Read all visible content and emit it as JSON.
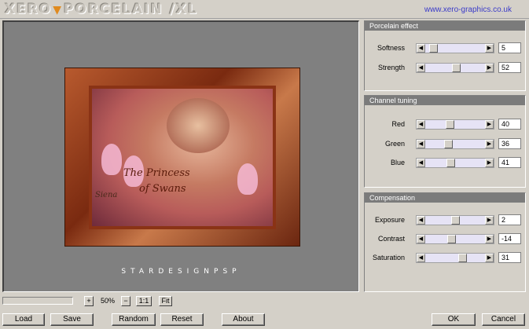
{
  "header": {
    "logo_left": "XERO",
    "logo_right": "PORCELAIN /XL",
    "website": "www.xero-graphics.co.uk"
  },
  "preview": {
    "art_title": "The Princess",
    "art_subtitle": "of Swans",
    "art_signature": "Siena",
    "watermark": "STARDESIGNPSP"
  },
  "panels": [
    {
      "title": "Porcelain effect",
      "sliders": [
        {
          "label": "Softness",
          "value": "5",
          "level": 0.05
        },
        {
          "label": "Strength",
          "value": "52",
          "level": 0.52
        }
      ]
    },
    {
      "title": "Channel tuning",
      "sliders": [
        {
          "label": "Red",
          "value": "40",
          "level": 0.4
        },
        {
          "label": "Green",
          "value": "36",
          "level": 0.36
        },
        {
          "label": "Blue",
          "value": "41",
          "level": 0.41
        }
      ]
    },
    {
      "title": "Compensation",
      "sliders": [
        {
          "label": "Exposure",
          "value": "2",
          "level": 0.51
        },
        {
          "label": "Contrast",
          "value": "-14",
          "level": 0.43
        },
        {
          "label": "Saturation",
          "value": "31",
          "level": 0.65
        }
      ]
    }
  ],
  "zoom": {
    "plus": "+",
    "level": "50%",
    "minus": "−",
    "one_to_one": "1:1",
    "fit": "Fit"
  },
  "buttons": {
    "load": "Load",
    "save": "Save",
    "random": "Random",
    "reset": "Reset",
    "about": "About",
    "ok": "OK",
    "cancel": "Cancel"
  },
  "colors": {
    "accent": "#e08a1e",
    "panel_title_bg": "#7b7b7b",
    "slider_track": "#e6e3f5",
    "link": "#3b3bc9"
  }
}
